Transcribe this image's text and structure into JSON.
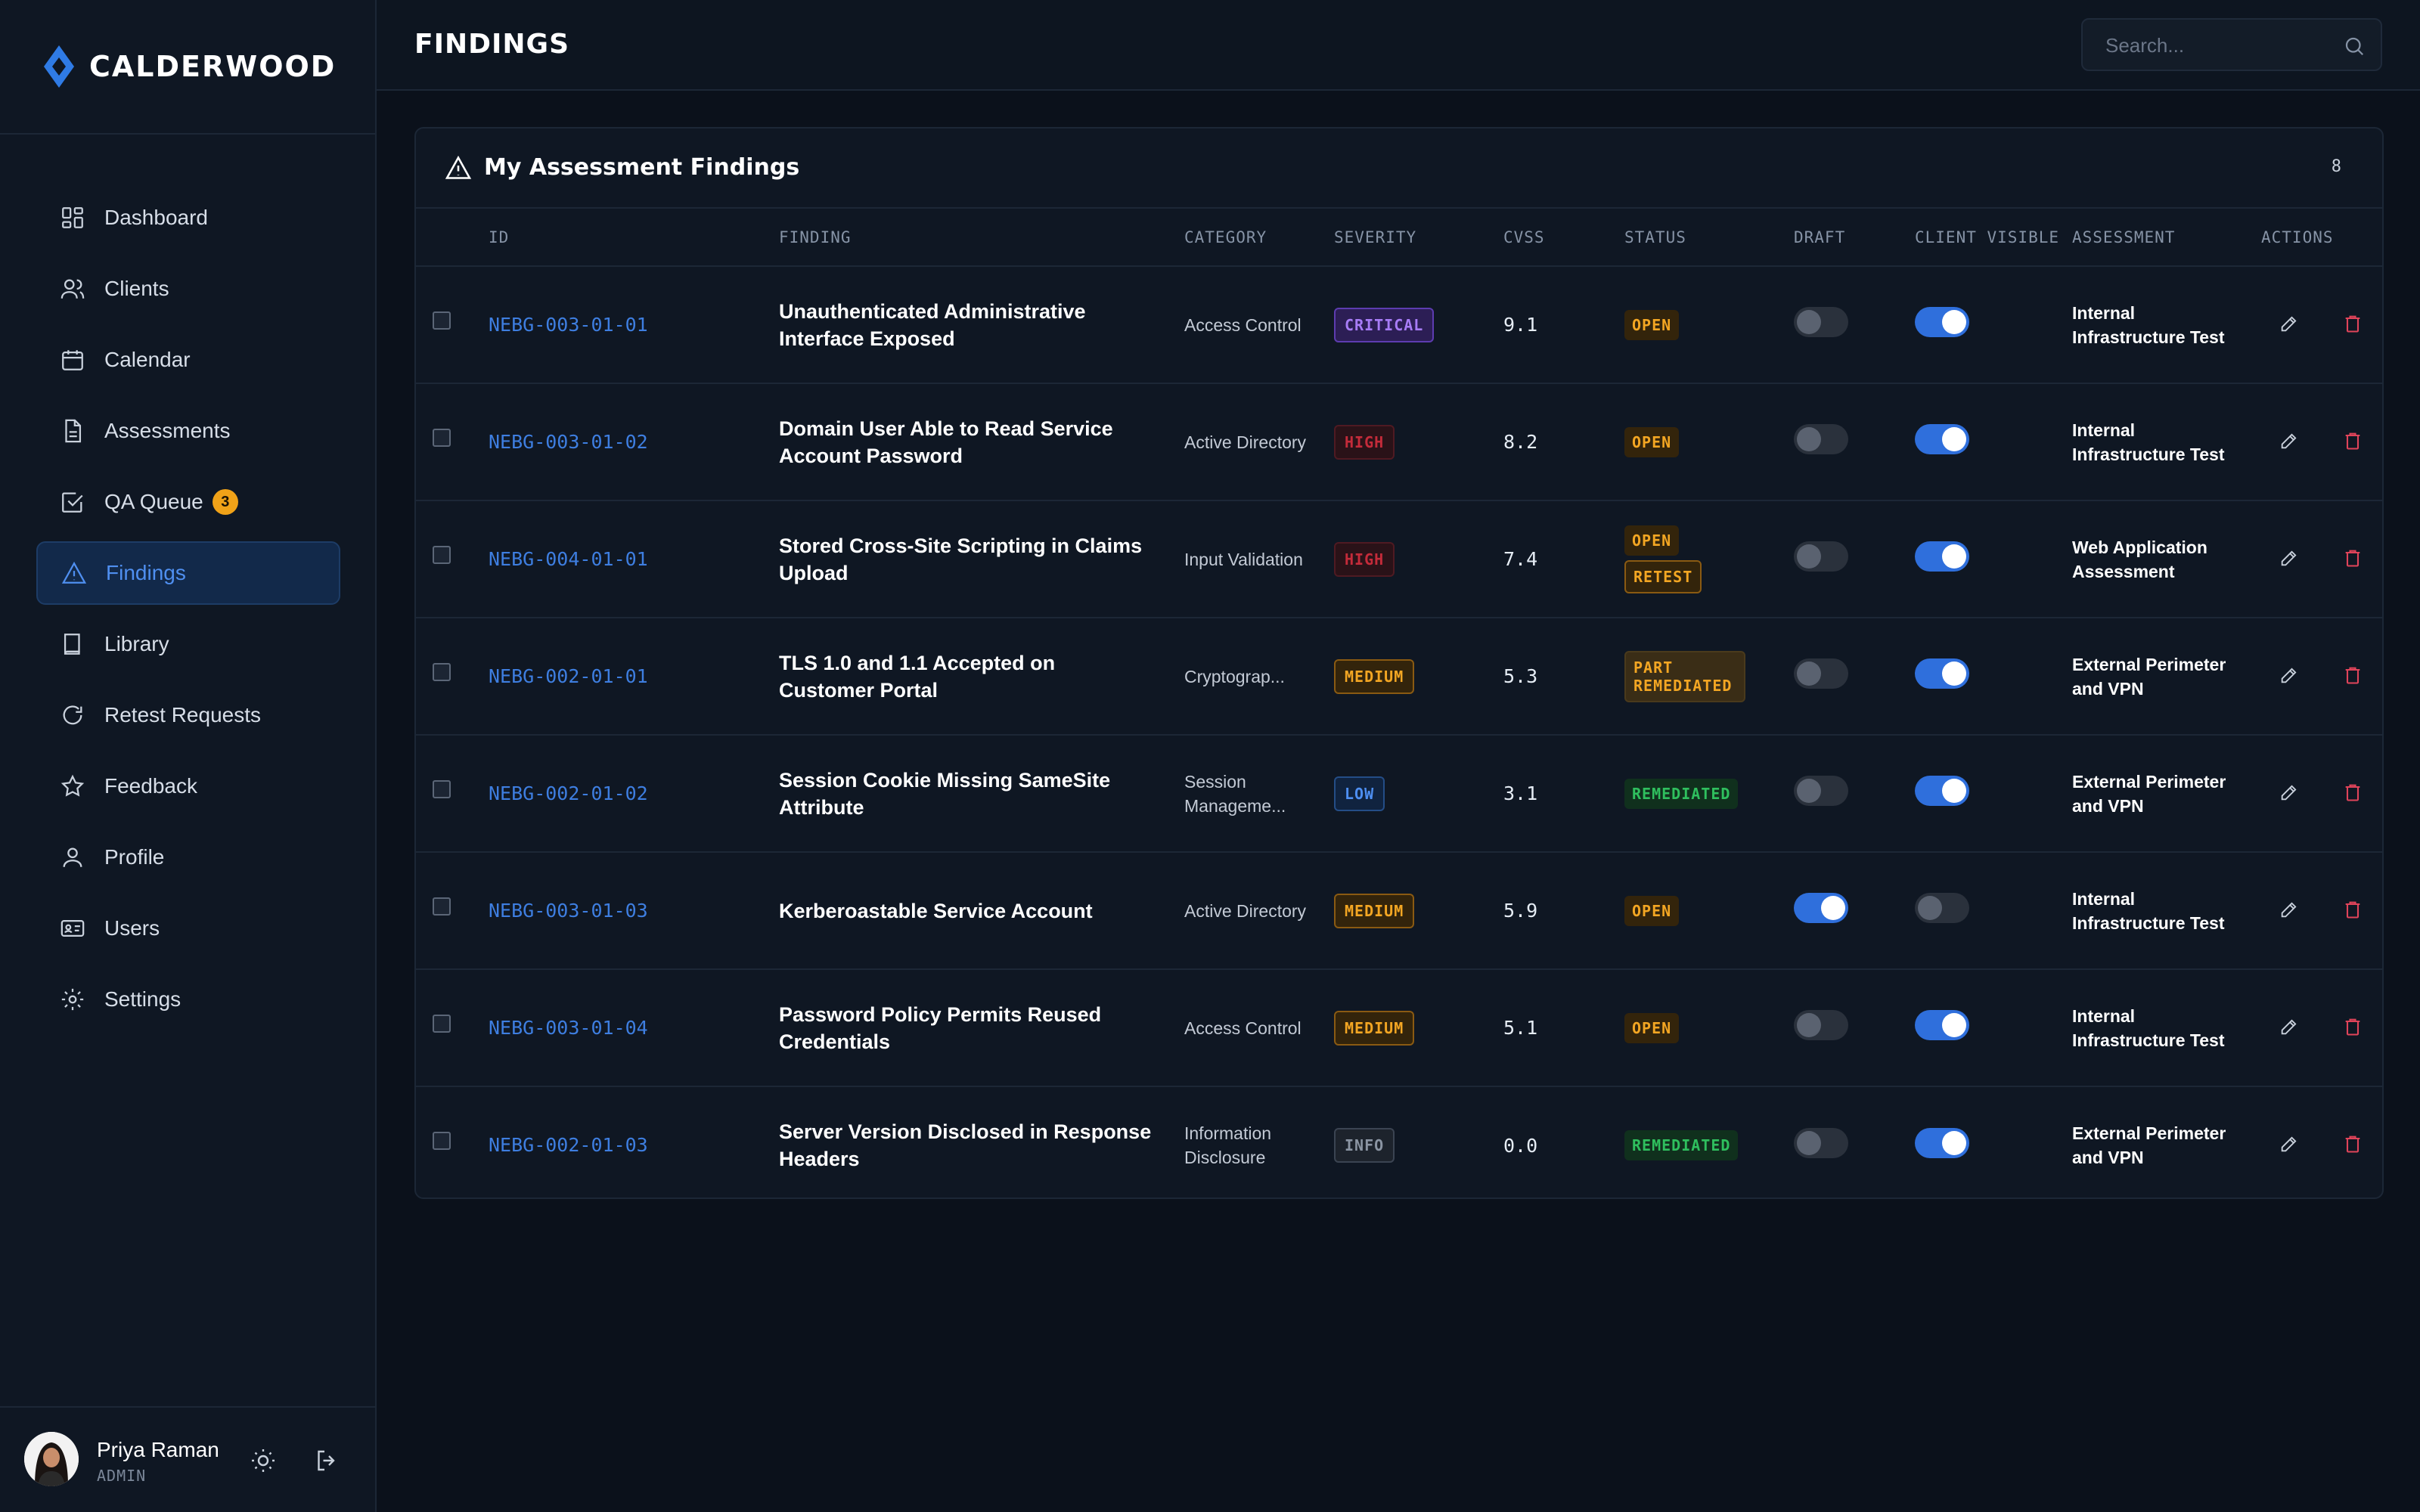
{
  "app": {
    "name": "CALDERWOOD",
    "page_title": "FINDINGS",
    "search_placeholder": "Search..."
  },
  "sidebar": {
    "items": [
      {
        "label": "Dashboard",
        "icon": "dashboard-icon"
      },
      {
        "label": "Clients",
        "icon": "users-icon"
      },
      {
        "label": "Calendar",
        "icon": "calendar-icon"
      },
      {
        "label": "Assessments",
        "icon": "document-icon"
      },
      {
        "label": "QA Queue",
        "icon": "check-square-icon",
        "badge": "3"
      },
      {
        "label": "Findings",
        "icon": "warning-triangle-icon",
        "active": true
      },
      {
        "label": "Library",
        "icon": "book-icon"
      },
      {
        "label": "Retest Requests",
        "icon": "refresh-icon"
      },
      {
        "label": "Feedback",
        "icon": "star-icon"
      },
      {
        "label": "Profile",
        "icon": "user-icon"
      },
      {
        "label": "Users",
        "icon": "id-card-icon"
      },
      {
        "label": "Settings",
        "icon": "gear-icon"
      }
    ]
  },
  "user": {
    "name": "Priya Raman",
    "role": "ADMIN"
  },
  "panel": {
    "title": "My Assessment Findings",
    "count": "8"
  },
  "table": {
    "columns": [
      "ID",
      "FINDING",
      "CATEGORY",
      "SEVERITY",
      "CVSS",
      "STATUS",
      "DRAFT",
      "CLIENT VISIBLE",
      "ASSESSMENT",
      "ACTIONS"
    ],
    "rows": [
      {
        "id": "NEBG-003-01-01",
        "finding": "Unauthenticated Administrative Interface Exposed",
        "category": "Access Control",
        "severity": "CRITICAL",
        "cvss": "9.1",
        "status": [
          "OPEN"
        ],
        "draft": false,
        "client_visible": true,
        "assessment": "Internal Infrastructure Test"
      },
      {
        "id": "NEBG-003-01-02",
        "finding": "Domain User Able to Read Service Account Password",
        "category": "Active Directory",
        "severity": "HIGH",
        "cvss": "8.2",
        "status": [
          "OPEN"
        ],
        "draft": false,
        "client_visible": true,
        "assessment": "Internal Infrastructure Test"
      },
      {
        "id": "NEBG-004-01-01",
        "finding": "Stored Cross-Site Scripting in Claims Upload",
        "category": "Input Validation",
        "severity": "HIGH",
        "cvss": "7.4",
        "status": [
          "OPEN",
          "RETEST"
        ],
        "draft": false,
        "client_visible": true,
        "assessment": "Web Application Assessment"
      },
      {
        "id": "NEBG-002-01-01",
        "finding": "TLS 1.0 and 1.1 Accepted on Customer Portal",
        "category": "Cryptograp...",
        "severity": "MEDIUM",
        "cvss": "5.3",
        "status": [
          "PART REMEDIATED"
        ],
        "draft": false,
        "client_visible": true,
        "assessment": "External Perimeter and VPN"
      },
      {
        "id": "NEBG-002-01-02",
        "finding": "Session Cookie Missing SameSite Attribute",
        "category": "Session Manageme...",
        "severity": "LOW",
        "cvss": "3.1",
        "status": [
          "REMEDIATED"
        ],
        "draft": false,
        "client_visible": true,
        "assessment": "External Perimeter and VPN"
      },
      {
        "id": "NEBG-003-01-03",
        "finding": "Kerberoastable Service Account",
        "category": "Active Directory",
        "severity": "MEDIUM",
        "cvss": "5.9",
        "status": [
          "OPEN"
        ],
        "draft": true,
        "client_visible": false,
        "assessment": "Internal Infrastructure Test"
      },
      {
        "id": "NEBG-003-01-04",
        "finding": "Password Policy Permits Reused Credentials",
        "category": "Access Control",
        "severity": "MEDIUM",
        "cvss": "5.1",
        "status": [
          "OPEN"
        ],
        "draft": false,
        "client_visible": true,
        "assessment": "Internal Infrastructure Test"
      },
      {
        "id": "NEBG-002-01-03",
        "finding": "Server Version Disclosed in Response Headers",
        "category": "Information Disclosure",
        "severity": "INFO",
        "cvss": "0.0",
        "status": [
          "REMEDIATED"
        ],
        "draft": false,
        "client_visible": true,
        "assessment": "External Perimeter and VPN"
      }
    ]
  },
  "colors": {
    "accent": "#2f6fdc",
    "link": "#3e7ee0",
    "background": "#0b111b",
    "sidebar": "#0f1723",
    "badge": "#f0a218"
  }
}
